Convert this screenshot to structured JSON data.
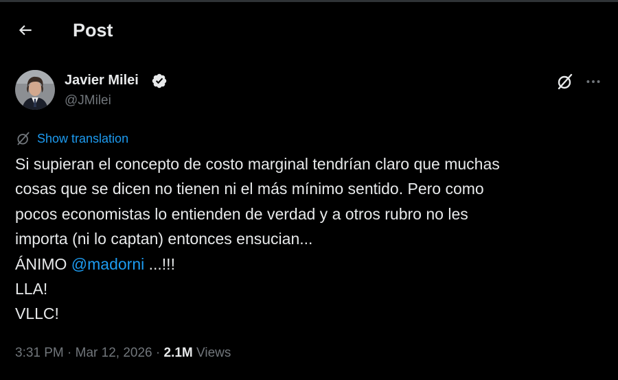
{
  "header": {
    "title": "Post"
  },
  "author": {
    "display_name": "Javier Milei",
    "handle": "@JMilei"
  },
  "translate": {
    "label": "Show translation"
  },
  "tweet": {
    "line1": "Si supieran el concepto de costo marginal tendrían claro que muchas",
    "line2": "cosas que se dicen no tienen ni el más mínimo sentido. Pero como",
    "line3": "pocos economistas lo entienden de verdad y a otros rubro no les",
    "line4": "importa (ni lo captan) entonces ensucian...",
    "line5_prefix": "ÁNIMO ",
    "line5_mention": "@madorni",
    "line5_suffix": " ...!!!",
    "line6": "LLA!",
    "line7": "VLLC!"
  },
  "meta": {
    "time": "3:31 PM",
    "sep1": " · ",
    "date": "Mar 12, 2026",
    "sep2": " · ",
    "views_count": "2.1M",
    "views_label": " Views"
  },
  "icons": {
    "back": "arrow-left-icon",
    "verified": "verified-badge-icon",
    "grok": "grok-icon",
    "more": "more-horizontal-icon",
    "translate": "translate-icon"
  },
  "colors": {
    "background": "#000000",
    "text": "#e7e9ea",
    "secondary": "#71767b",
    "accent": "#1d9bf0"
  }
}
